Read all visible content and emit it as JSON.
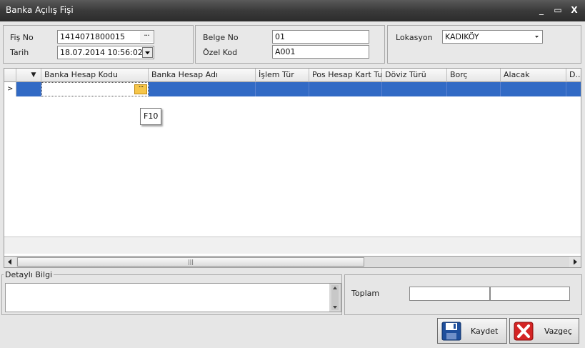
{
  "window": {
    "title": "Banka Açılış Fişi",
    "min": "_",
    "max": "▭",
    "close": "X"
  },
  "header": {
    "fis_no_label": "Fiş No",
    "fis_no_value": "1414071800015",
    "tarih_label": "Tarih",
    "tarih_value": "18.07.2014 10:56:02",
    "belge_no_label": "Belge No",
    "belge_no_value": "01",
    "ozel_kod_label": "Özel Kod",
    "ozel_kod_value": "A001",
    "lokasyon_label": "Lokasyon",
    "lokasyon_value": "KADIKÖY",
    "ellipsis": "···"
  },
  "grid": {
    "columns": [
      "Banka Hesap Kodu",
      "Banka Hesap Adı",
      "İşlem Tür",
      "Pos Hesap Kart Tur",
      "Döviz Türü",
      "Borç",
      "Alacak",
      "D..."
    ],
    "filter_glyph": "▼",
    "row_indicator": ">",
    "cell_ellipsis": "···",
    "tooltip": "F10",
    "scroll_grip": "|||"
  },
  "detail": {
    "legend": "Detaylı Bilgi"
  },
  "totals": {
    "label": "Toplam"
  },
  "buttons": {
    "save": "Kaydet",
    "cancel": "Vazgeç"
  },
  "colors": {
    "selection": "#316ac5",
    "titlebar": "#3a3a3a",
    "cell_button": "#f6c64a"
  }
}
